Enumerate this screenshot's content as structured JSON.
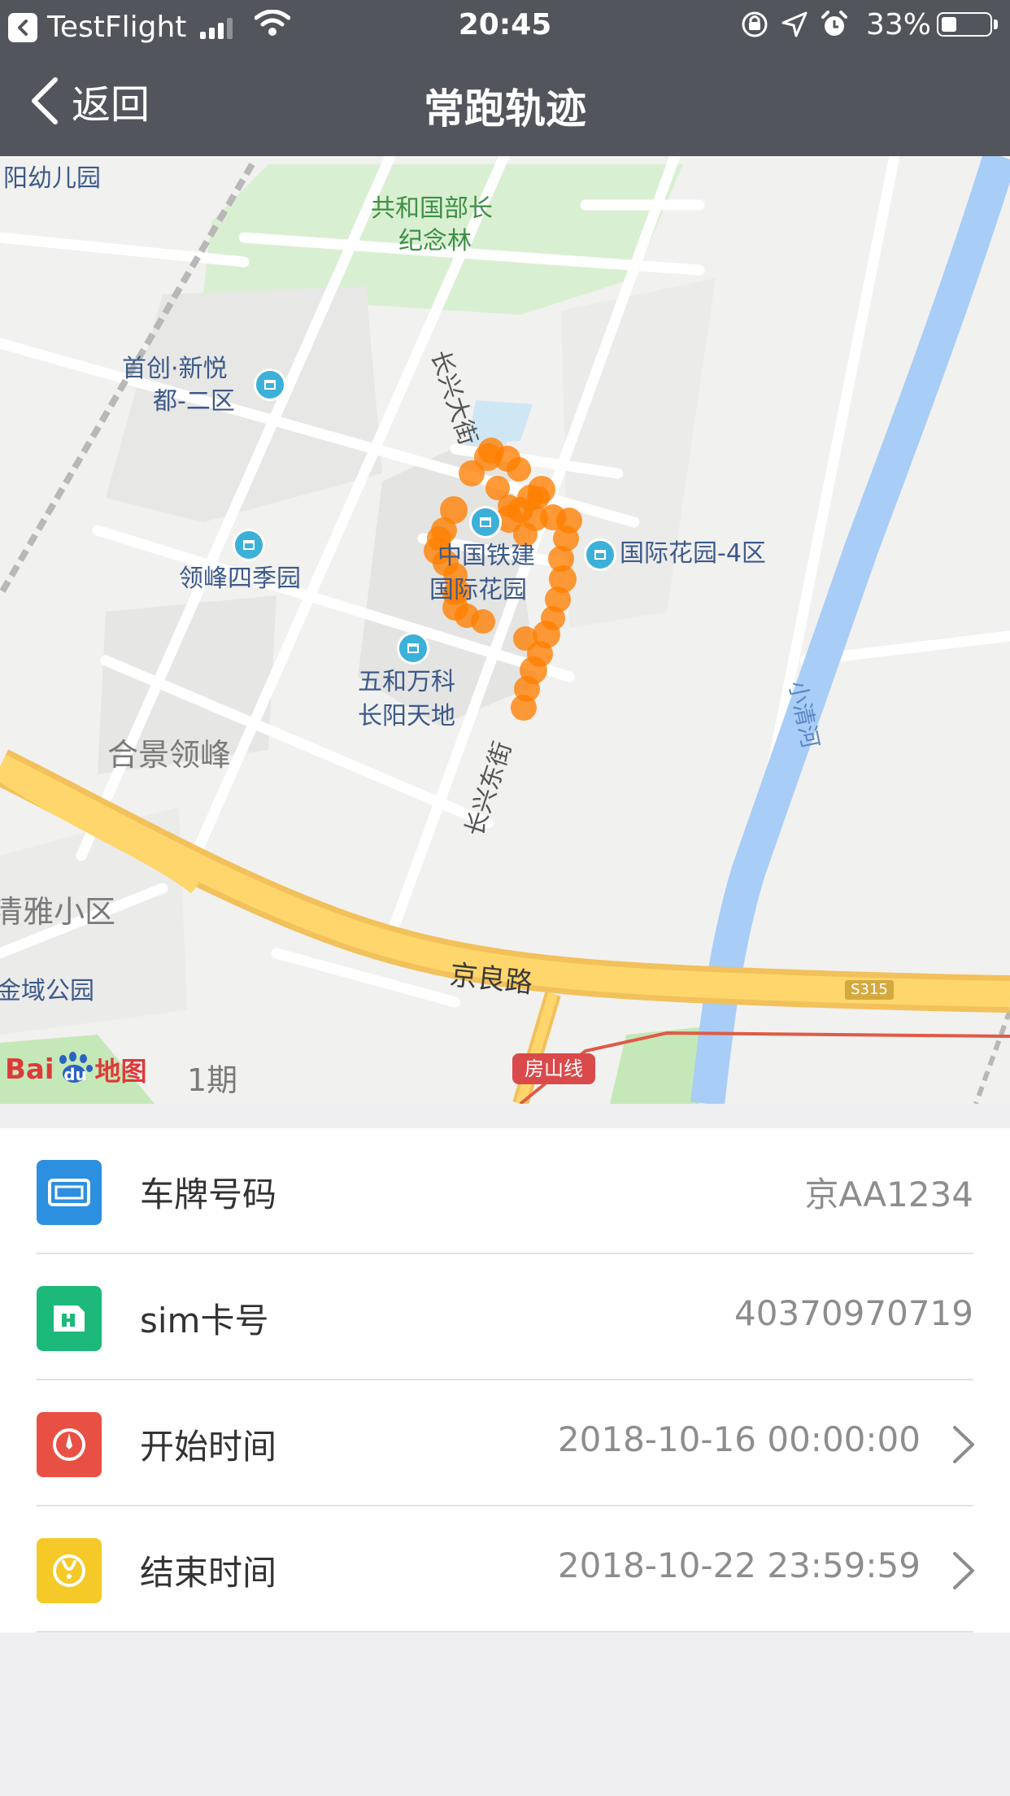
{
  "status_bar": {
    "back_app_label": "TestFlight",
    "time": "20:45",
    "battery_percent": "33%",
    "battery_level": 0.33
  },
  "nav": {
    "back_label": "返回",
    "title": "常跑轨迹"
  },
  "map": {
    "labels": {
      "kindergarten": "阳幼儿园",
      "memorial_forest_1": "共和国部长",
      "memorial_forest_2": "纪念林",
      "changxing_street": "长兴大街",
      "shouchuang_1": "首创·新悦",
      "shouchuang_2": "都-二区",
      "lingfeng_siji": "领峰四季园",
      "china_railway_1": "中国铁建",
      "china_railway_2": "国际花园",
      "intl_garden_4": "国际花园-4区",
      "wuhe_1": "五和万科",
      "wuhe_2": "长阳天地",
      "hejing": "合景领峰",
      "changxing_east": "长兴东街",
      "qingya": "清雅小区",
      "jinyu": "金域公园",
      "jingliang_road": "京良路",
      "xiaoqing_river": "小清河",
      "s315": "S315",
      "fangshan_line": "房山线",
      "phase_1": "1期",
      "baidu_logo": "Bai",
      "baidu_du": "du",
      "baidu_ditu": "地图"
    },
    "route_color": "#ff7f00"
  },
  "info": {
    "rows": [
      {
        "label": "车牌号码",
        "value": "京AA1234",
        "icon": "license-plate-icon",
        "color": "#2d8fe0"
      },
      {
        "label": "sim卡号",
        "value": "40370970719",
        "icon": "sim-card-icon",
        "color": "#1cb97a"
      },
      {
        "label": "开始时间",
        "value": "2018-10-16 00:00:00",
        "icon": "start-time-icon",
        "color": "#e95044"
      },
      {
        "label": "结束时间",
        "value": "2018-10-22 23:59:59",
        "icon": "end-time-icon",
        "color": "#f5c928"
      }
    ]
  }
}
